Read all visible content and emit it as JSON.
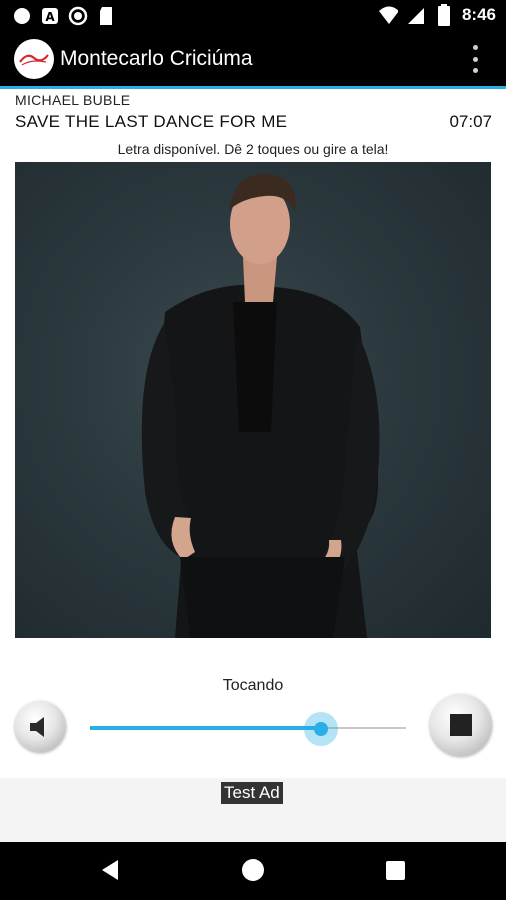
{
  "status_bar": {
    "time": "8:46",
    "left_icons": [
      "circle-notification-icon",
      "android-a-icon",
      "record-icon",
      "sd-card-icon"
    ],
    "right_icons": [
      "wifi-icon",
      "signal-icon",
      "battery-icon"
    ]
  },
  "app_bar": {
    "title": "Montecarlo Criciúma",
    "logo": "montecarlo-logo",
    "menu_icon": "overflow-menu-icon"
  },
  "now_playing": {
    "artist": "MICHAEL BUBLE",
    "title": "SAVE THE LAST DANCE FOR ME",
    "time": "07:07",
    "lyrics_hint": "Letra disponível. Dê 2 toques ou gire a tela!"
  },
  "player": {
    "status": "Tocando",
    "volume_percent": 73,
    "volume_icon": "speaker-icon",
    "stop_icon": "stop-icon"
  },
  "ad": {
    "label": "Test Ad"
  },
  "nav_bar": {
    "icons": [
      "back-icon",
      "home-icon",
      "recents-icon"
    ]
  },
  "colors": {
    "accent": "#29aee5",
    "bar_background": "#000000"
  }
}
